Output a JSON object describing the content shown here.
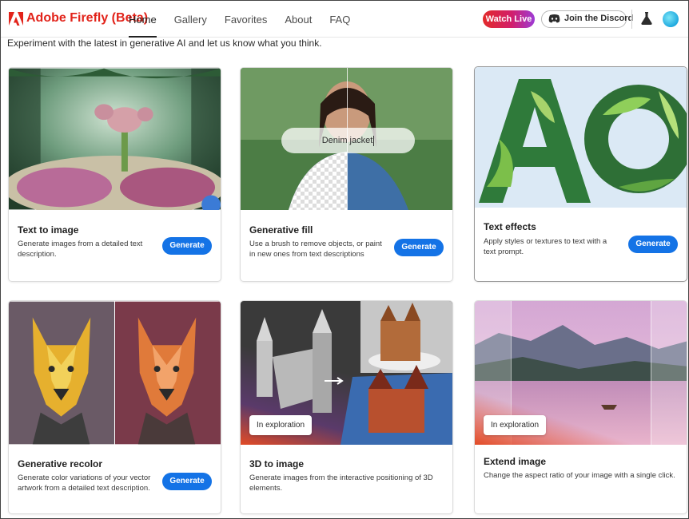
{
  "header": {
    "brand": "Adobe Firefly (Beta)",
    "nav": [
      "Home",
      "Gallery",
      "Favorites",
      "About",
      "FAQ"
    ],
    "active_nav": "Home",
    "watch_live": "Watch Live",
    "discord": "Join the Discord"
  },
  "intro": "Experiment with the latest in generative AI and let us know what you think.",
  "cards": [
    {
      "title": "Text to image",
      "description": "Generate images from a detailed text description.",
      "button": "Generate"
    },
    {
      "title": "Generative fill",
      "description": "Use a brush to remove objects, or paint in new ones from text descriptions",
      "button": "Generate",
      "overlay_text": "Denim jacket"
    },
    {
      "title": "Text effects",
      "description": "Apply styles or textures to text with a text prompt.",
      "button": "Generate"
    },
    {
      "title": "Generative recolor",
      "description": "Generate color variations of your vector artwork from a detailed text description.",
      "button": "Generate"
    },
    {
      "title": "3D to image",
      "description": "Generate images from the interactive positioning of 3D elements.",
      "badge": "In exploration"
    },
    {
      "title": "Extend image",
      "description": "Change the aspect ratio of your image with a single click.",
      "badge": "In exploration"
    }
  ],
  "colors": {
    "brand": "#e2231a",
    "accent": "#1473e6"
  }
}
